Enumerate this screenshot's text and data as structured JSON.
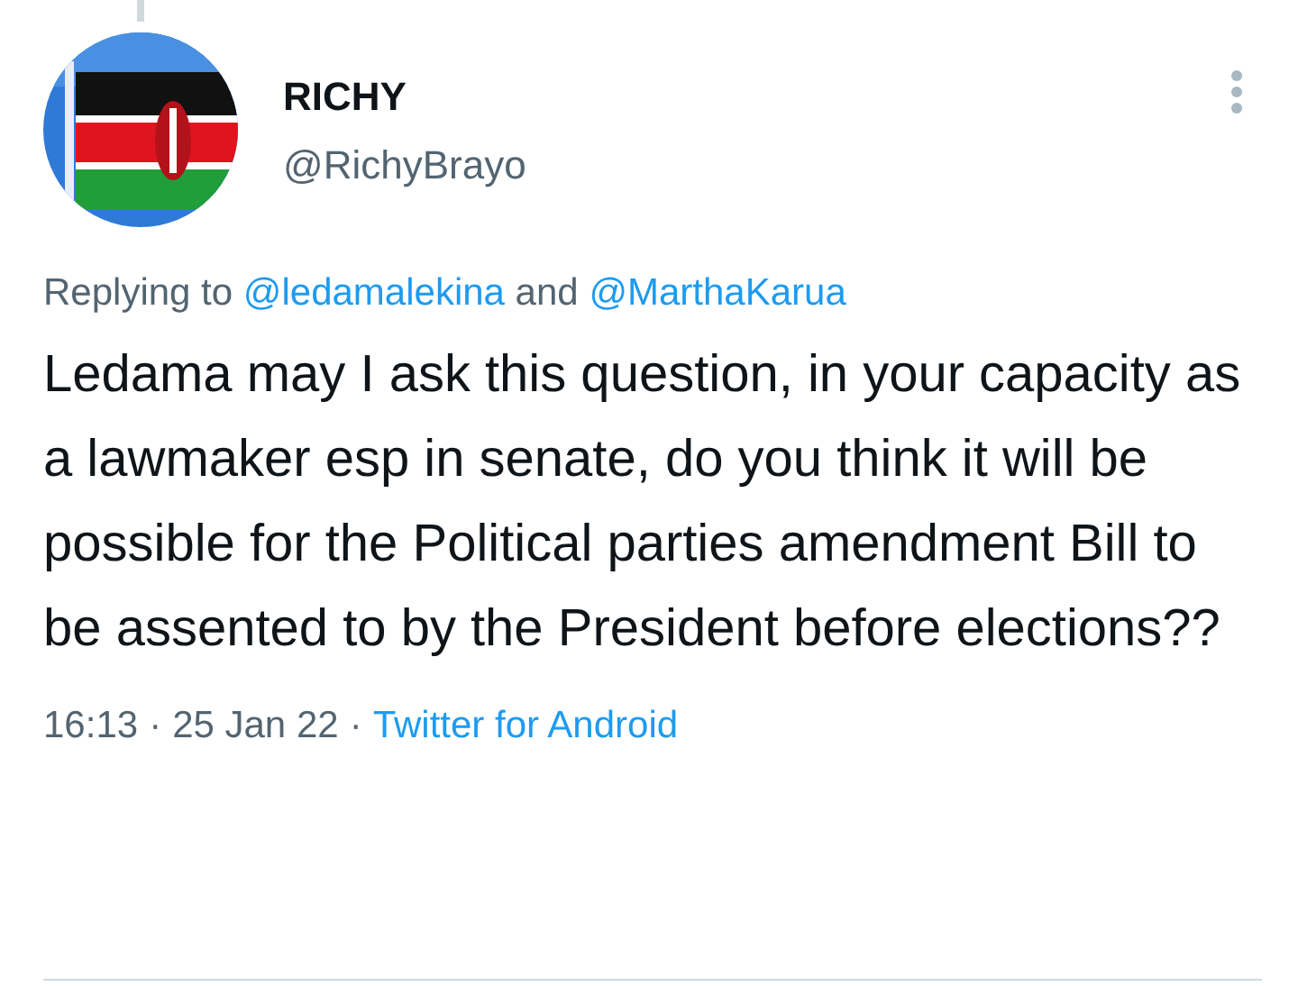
{
  "author": {
    "name": "RICHY",
    "handle": "@RichyBrayo"
  },
  "reply": {
    "prefix": "Replying to",
    "mentions": [
      "@ledamalekina",
      "@MarthaKarua"
    ],
    "joiner": "and"
  },
  "text": "Ledama may I ask this question, in your capacity as a lawmaker esp in senate, do you think it will be possible for the Political parties amendment Bill to be assented to by the President before elections??",
  "footer": {
    "time": "16:13",
    "separator": "·",
    "date": "25 Jan 22",
    "source": "Twitter for Android"
  }
}
